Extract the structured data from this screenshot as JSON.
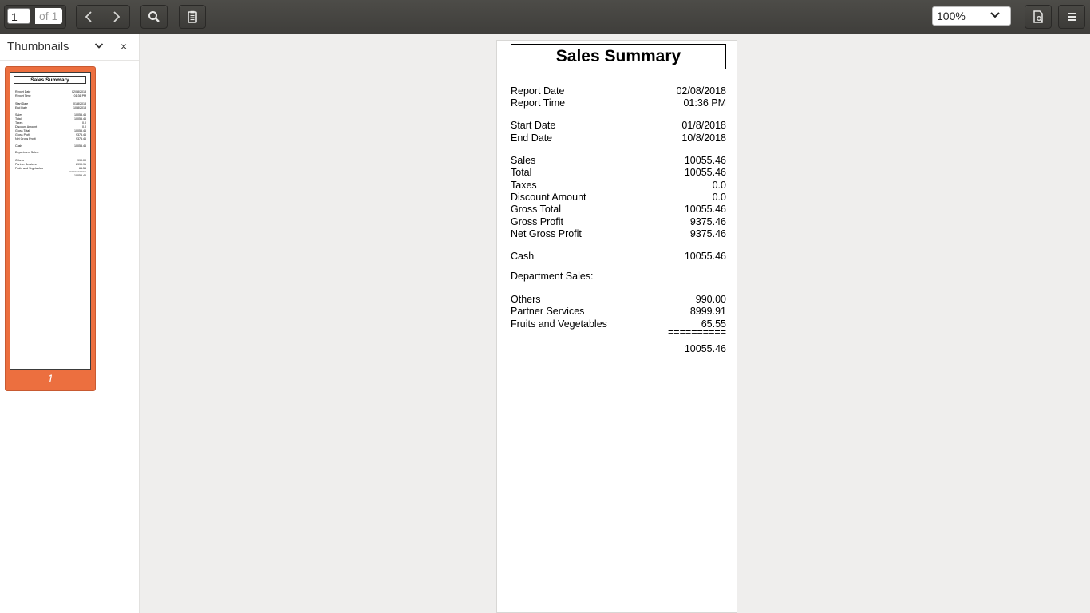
{
  "toolbar": {
    "page_number": "1",
    "page_of": "of 1",
    "zoom": "100%"
  },
  "sidebar": {
    "title": "Thumbnails",
    "thumbnail_page_label": "1"
  },
  "document": {
    "title": "Sales Summary",
    "rows": [
      {
        "label": "Report Date",
        "value": "02/08/2018"
      },
      {
        "label": "Report Time",
        "value": "01:36 PM"
      },
      {
        "label": "Start Date",
        "value": "01/8/2018"
      },
      {
        "label": "End Date",
        "value": "10/8/2018"
      },
      {
        "label": "Sales",
        "value": "10055.46"
      },
      {
        "label": "Total",
        "value": "10055.46"
      },
      {
        "label": "Taxes",
        "value": "0.0"
      },
      {
        "label": "Discount Amount",
        "value": "0.0"
      },
      {
        "label": "Gross Total",
        "value": "10055.46"
      },
      {
        "label": "Gross Profit",
        "value": "9375.46"
      },
      {
        "label": "Net Gross Profit",
        "value": "9375.46"
      },
      {
        "label": "Cash",
        "value": "10055.46"
      },
      {
        "label": "Department Sales:",
        "value": ""
      },
      {
        "label": "Others",
        "value": "990.00"
      },
      {
        "label": "Partner Services",
        "value": "8999.91"
      },
      {
        "label": "Fruits and Vegetables",
        "value": "65.55"
      },
      {
        "label": "",
        "value": "=========="
      },
      {
        "label": "",
        "value": "10055.46"
      }
    ]
  },
  "icons": {
    "prev": "chevron-left-icon",
    "next": "chevron-right-icon",
    "search": "search-icon",
    "annotations": "clipboard-icon",
    "zoom_dropdown": "chevron-down-icon",
    "document_properties": "document-properties-icon",
    "menu": "hamburger-menu-icon",
    "sidebar_dropdown": "chevron-down-icon",
    "sidebar_close": "close-icon"
  },
  "colors": {
    "toolbar": "#45443f",
    "thumbnail_selected": "#ec6f3f",
    "background": "#efeeed"
  }
}
